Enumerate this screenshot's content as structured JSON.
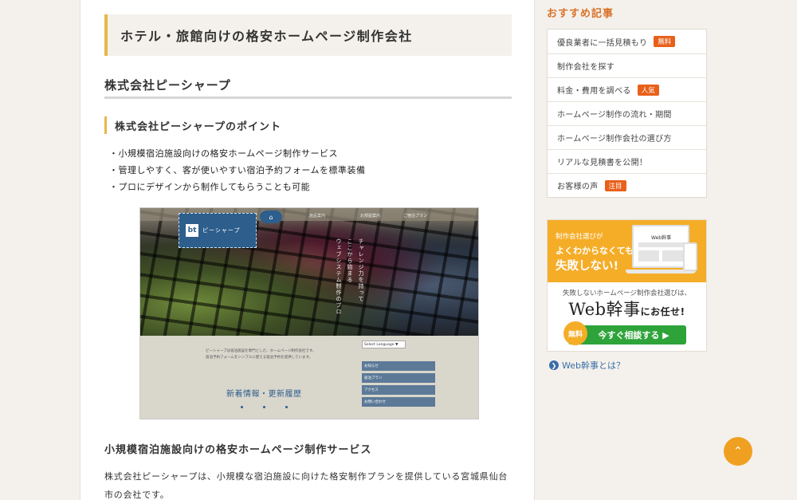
{
  "main": {
    "page_heading": "ホテル・旅館向けの格安ホームページ制作会社",
    "company_heading": "株式会社ピーシャープ",
    "points_heading": "株式会社ピーシャープのポイント",
    "points": [
      "・小規模宿泊施設向けの格安ホームページ制作サービス",
      "・管理しやすく、客が使いやすい宿泊予約フォームを標準装備",
      "・プロにデザインから制作してもらうことも可能"
    ],
    "screenshot": {
      "logo_mark": "bt",
      "logo_text": "ピーシャープ",
      "home_icon": "⌂",
      "nav": [
        "施設案内",
        "お部屋案内",
        "ご宿泊プラン"
      ],
      "vertical_lines": [
        "チャレンジ力を持って",
        "ここから始まる",
        "ウェブシステム制作のプロ"
      ],
      "lower_text": [
        "ピーシャープは宿泊施設を専門とした、ホームページ制作会社です。",
        "宿泊予約フォームをシンプルに使える宿泊予約を提供しています。"
      ],
      "translate_label": "Select Language ▼",
      "button_list": [
        "お知らせ",
        "宿泊プラン",
        "アクセス",
        "お問い合わせ"
      ],
      "news_title": "新着情報・更新履歴"
    },
    "service_heading": "小規模宿泊施設向けの格安ホームページ制作サービス",
    "description": "株式会社ピーシャープは、小規模な宿泊施設に向けた格安制作プランを提供している宮城県仙台市の会社です。"
  },
  "sidebar": {
    "title": "おすすめ記事",
    "items": [
      {
        "label": "優良業者に一括見積もり",
        "badge": "無料"
      },
      {
        "label": "制作会社を探す",
        "badge": ""
      },
      {
        "label": "料金・費用を調べる",
        "badge": "人気"
      },
      {
        "label": "ホームページ制作の流れ・期間",
        "badge": ""
      },
      {
        "label": "ホームページ制作会社の選び方",
        "badge": ""
      },
      {
        "label": "リアルな見積書を公開！",
        "badge": ""
      },
      {
        "label": "お客様の声",
        "badge": "注目"
      }
    ],
    "banner": {
      "line1": "制作会社選びが",
      "line2": "よくわからなくても",
      "line3": "失敗しない!",
      "laptop_label": "Web幹事",
      "sub": "失敗しないホームページ制作会社選びは、",
      "brand": "Web幹事",
      "brand_tail": "にお任せ!",
      "free_badge": "無料",
      "cta": "今すぐ相談する ▶"
    },
    "link_icon": "❯",
    "link": "Web幹事とは？"
  },
  "scroll_top_icon": "⌃",
  "colors": {
    "accent": "#e8b64a",
    "side_title": "#d9732a",
    "badge": "#e8601a",
    "banner": "#f5ad28",
    "cta": "#2ea33a",
    "link": "#3b6ea8",
    "to_top": "#f0a020"
  }
}
